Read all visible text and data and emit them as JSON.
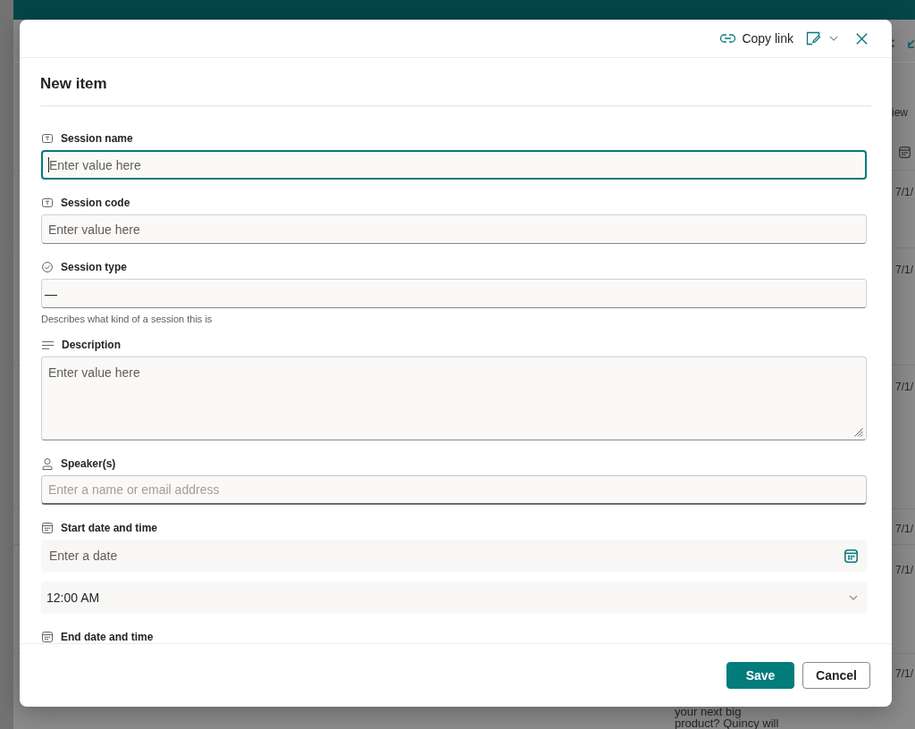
{
  "background": {
    "view_label": "iew",
    "rows": [
      {
        "date": "7/1/"
      },
      {
        "date": "7/1/"
      },
      {
        "date": "7/1/"
      },
      {
        "date": "7/1/"
      },
      {
        "date": "7/1/"
      },
      {
        "date": "7/1/",
        "description": "your next big product? Quincy will"
      }
    ]
  },
  "dialog": {
    "copy_link": "Copy link",
    "title": "New item",
    "fields": [
      {
        "kind": "text",
        "label": "Session name",
        "placeholder": "Enter value here",
        "focused": true
      },
      {
        "kind": "text",
        "label": "Session code",
        "placeholder": "Enter value here",
        "focused": false
      },
      {
        "kind": "choice",
        "label": "Session type",
        "value": "—",
        "hint": "Describes what kind of a session this is",
        "focused": false
      },
      {
        "kind": "multiline",
        "label": "Description",
        "placeholder": "Enter value here",
        "focused": false
      },
      {
        "kind": "person",
        "label": "Speaker(s)",
        "placeholder": "Enter a name or email address",
        "focused": false
      },
      {
        "kind": "datetime",
        "label": "Start date and time",
        "placeholder": "Enter a date",
        "time": "12:00 AM",
        "focused": false
      },
      {
        "kind": "datetime",
        "label": "End date and time"
      }
    ],
    "buttons": [
      {
        "label": "Save",
        "primary": true
      },
      {
        "label": "Cancel",
        "primary": false
      }
    ]
  }
}
